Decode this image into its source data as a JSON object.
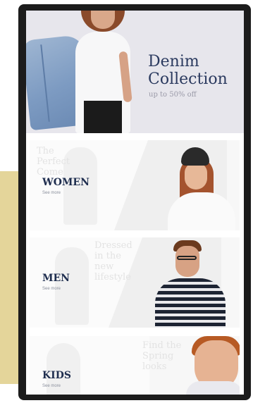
{
  "hero": {
    "title": "Denim Collection",
    "subtitle": "up to 50% off"
  },
  "categories": [
    {
      "label": "WOMEN",
      "see_more": "See more",
      "ghost_text": "The\nPerfect\nCome"
    },
    {
      "label": "MEN",
      "see_more": "See more",
      "ghost_text": "Dressed\nin the\nnew\nlifestyle"
    },
    {
      "label": "KIDS",
      "see_more": "See more",
      "ghost_text": "Find the\nSpring\nlooks"
    }
  ],
  "colors": {
    "accent_block": "#e4d59a",
    "device_frame": "#1c1c1c",
    "title_navy": "#2b3a5f",
    "hero_bg": "#e7e6ec"
  }
}
